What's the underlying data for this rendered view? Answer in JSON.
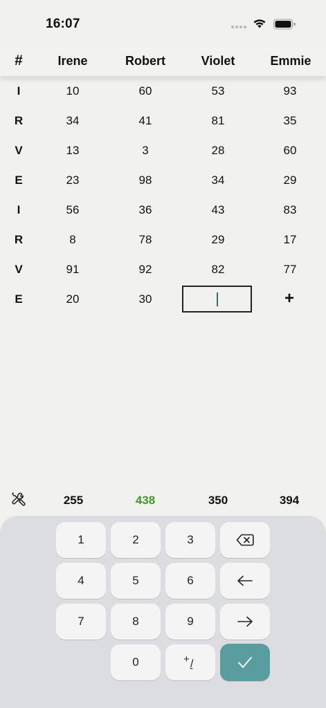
{
  "status_bar": {
    "time": "16:07",
    "icons": [
      "cellular-dots-icon",
      "wifi-icon",
      "battery-icon"
    ]
  },
  "table": {
    "header": [
      "#",
      "Irene",
      "Robert",
      "Violet",
      "Emmie"
    ],
    "rows": [
      {
        "label": "I",
        "values": [
          "10",
          "60",
          "53",
          "93"
        ]
      },
      {
        "label": "R",
        "values": [
          "34",
          "41",
          "81",
          "35"
        ]
      },
      {
        "label": "V",
        "values": [
          "13",
          "3",
          "28",
          "60"
        ]
      },
      {
        "label": "E",
        "values": [
          "23",
          "98",
          "34",
          "29"
        ]
      },
      {
        "label": "I",
        "values": [
          "56",
          "36",
          "43",
          "83"
        ]
      },
      {
        "label": "R",
        "values": [
          "8",
          "78",
          "29",
          "17"
        ]
      },
      {
        "label": "V",
        "values": [
          "91",
          "92",
          "82",
          "77"
        ]
      },
      {
        "label": "E",
        "values": [
          "20",
          "30",
          "",
          ""
        ]
      }
    ],
    "active_cell_value": "",
    "add_label": "+"
  },
  "totals": {
    "values": [
      "255",
      "438",
      "350",
      "394"
    ],
    "highlight_color": "#3f9a1f",
    "settings_icon": "tools-icon"
  },
  "keypad": {
    "keys": [
      "1",
      "2",
      "3",
      "4",
      "5",
      "6",
      "7",
      "8",
      "9",
      "0"
    ],
    "backspace_icon": "backspace-icon",
    "left_icon": "arrow-left-icon",
    "right_icon": "arrow-right-icon",
    "plus_minus_label": "+/-",
    "confirm_icon": "checkmark-icon",
    "confirm_color": "#5a9d9e"
  }
}
